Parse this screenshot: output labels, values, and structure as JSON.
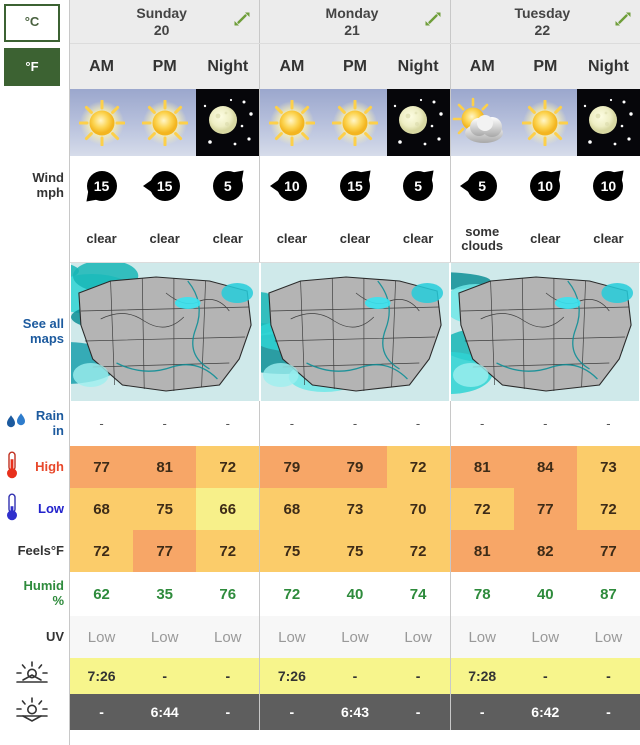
{
  "units": {
    "celsius_label": "°C",
    "fahrenheit_label": "°F",
    "selected": "°F"
  },
  "row_labels": {
    "wind": "Wind\nmph",
    "maps": "See all\nmaps",
    "rain": "Rain\nin",
    "high": "High",
    "low": "Low",
    "feels": "Feels°F",
    "humid": "Humid\n%",
    "uv": "UV",
    "sunrise": "sunrise-icon",
    "sunset": "sunset-icon"
  },
  "periods": [
    "AM",
    "PM",
    "Night"
  ],
  "days": [
    {
      "name": "Sunday",
      "date": "20",
      "expand": "expand-icon"
    },
    {
      "name": "Monday",
      "date": "21",
      "expand": "expand-icon"
    },
    {
      "name": "Tuesday",
      "date": "22",
      "expand": "expand-icon"
    }
  ],
  "chart_data": {
    "type": "table",
    "title": "3-Day Hourly Weather Forecast",
    "columns": [
      "Sunday 20 AM",
      "Sunday 20 PM",
      "Sunday 20 Night",
      "Monday 21 AM",
      "Monday 21 PM",
      "Monday 21 Night",
      "Tuesday 22 AM",
      "Tuesday 22 PM",
      "Tuesday 22 Night"
    ],
    "rows": {
      "sky_icon": [
        "sun",
        "sun",
        "moon",
        "sun",
        "sun",
        "moon",
        "sun-cloud",
        "sun",
        "moon"
      ],
      "wind_mph": [
        15,
        15,
        5,
        10,
        15,
        5,
        5,
        10,
        10
      ],
      "wind_dir": [
        "SW",
        "W",
        "NE",
        "W",
        "NE",
        "NE",
        "W",
        "NE",
        "NE"
      ],
      "condition": [
        "clear",
        "clear",
        "clear",
        "clear",
        "clear",
        "clear",
        "some\nclouds",
        "clear",
        "clear"
      ],
      "rain_in": [
        "-",
        "-",
        "-",
        "-",
        "-",
        "-",
        "-",
        "-",
        "-"
      ],
      "high_f": [
        77,
        81,
        72,
        79,
        79,
        72,
        81,
        84,
        73
      ],
      "low_f": [
        68,
        75,
        66,
        68,
        73,
        70,
        72,
        77,
        72
      ],
      "feels_f": [
        72,
        77,
        72,
        75,
        75,
        72,
        81,
        82,
        77
      ],
      "humidity": [
        62,
        35,
        76,
        72,
        40,
        74,
        78,
        40,
        87
      ],
      "uv": [
        "Low",
        "Low",
        "Low",
        "Low",
        "Low",
        "Low",
        "Low",
        "Low",
        "Low"
      ],
      "sunrise": [
        "7:26",
        "-",
        "-",
        "7:26",
        "-",
        "-",
        "7:28",
        "-",
        "-"
      ],
      "sunset": [
        "-",
        "6:44",
        "-",
        "-",
        "6:43",
        "-",
        "-",
        "6:42",
        "-"
      ]
    },
    "cell_colors": {
      "high_f": [
        "#f7a667",
        "#f7a667",
        "#fbcc6a",
        "#f7a667",
        "#f7a667",
        "#fbcc6a",
        "#f7a667",
        "#f7a667",
        "#fbcc6a"
      ],
      "low_f": [
        "#fbcc6a",
        "#fbcc6a",
        "#f7f08a",
        "#fbcc6a",
        "#fbcc6a",
        "#fbcc6a",
        "#fbcc6a",
        "#f7a667",
        "#fbcc6a"
      ],
      "feels_f": [
        "#fbcc6a",
        "#f7a667",
        "#fbcc6a",
        "#fbcc6a",
        "#fbcc6a",
        "#fbcc6a",
        "#f7a667",
        "#f7a667",
        "#f7a667"
      ]
    },
    "legend": {
      "hot": "#f7a667",
      "warm": "#fbcc6a",
      "mild": "#f7f08a",
      "humidity_text": "#2e8b3c",
      "sunrise_bg": "#f7f58c",
      "sunset_bg": "#5e5e5e"
    }
  }
}
